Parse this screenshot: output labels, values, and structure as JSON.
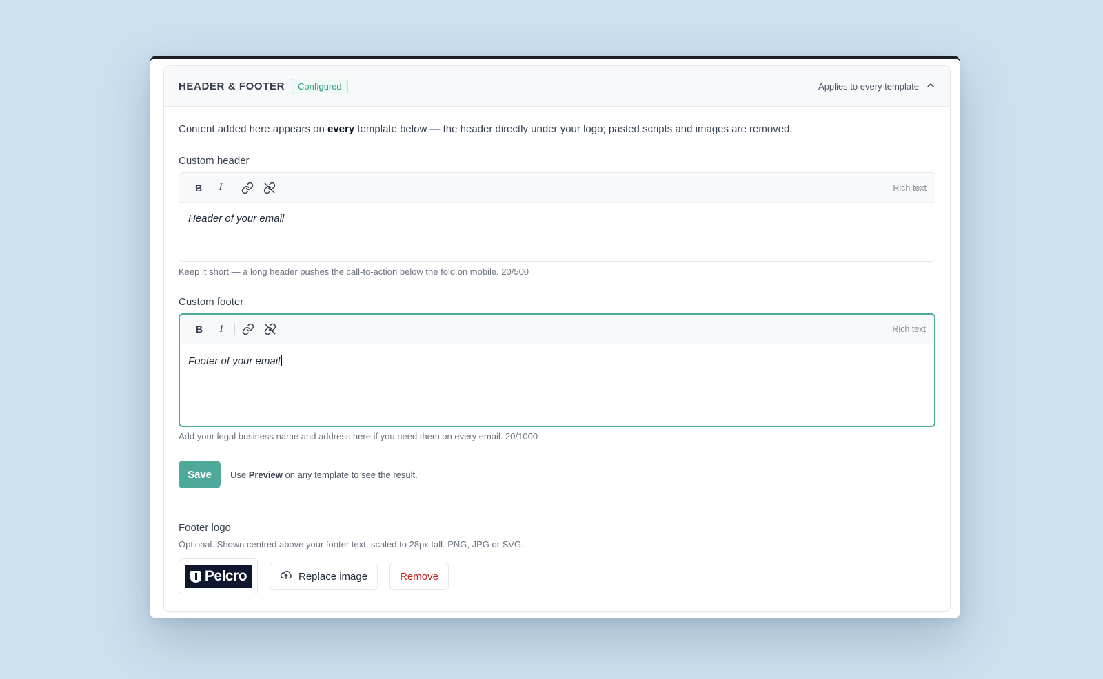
{
  "section": {
    "title": "HEADER & FOOTER",
    "badge": "Configured",
    "applies_label": "Applies to every template",
    "toggle_icon": "chevron-up-icon"
  },
  "intro": {
    "before": "Content added here appears on ",
    "emphasis": "every",
    "after": " template below — the header directly under your logo; pasted scripts and images are removed."
  },
  "toolbar": {
    "bold_label": "B",
    "italic_label": "I",
    "link_icon": "link-icon",
    "unlink_icon": "unlink-icon",
    "mode_label": "Rich text"
  },
  "header_editor": {
    "label": "Custom header",
    "value": "Header of your email",
    "hint": "Keep it short — a long header pushes the call-to-action below the fold on mobile. 20/500"
  },
  "footer_editor": {
    "label": "Custom footer",
    "value": "Footer of your email",
    "hint": "Add your legal business name and address here if you need them on every email. 20/1000"
  },
  "save": {
    "button_label": "Save",
    "note_before": "Use ",
    "note_emphasis": "Preview",
    "note_after": " on any template to see the result."
  },
  "footer_logo": {
    "title": "Footer logo",
    "description": "Optional. Shown centred above your footer text, scaled to 28px tall. PNG, JPG or SVG.",
    "logo_text": "Pelcro",
    "replace_label": "Replace image",
    "replace_icon": "upload-cloud-icon",
    "remove_label": "Remove"
  },
  "colors": {
    "accent": "#4fa99a",
    "danger": "#c81e1e",
    "background": "#cde0ee",
    "logo_background": "#0e1630"
  }
}
